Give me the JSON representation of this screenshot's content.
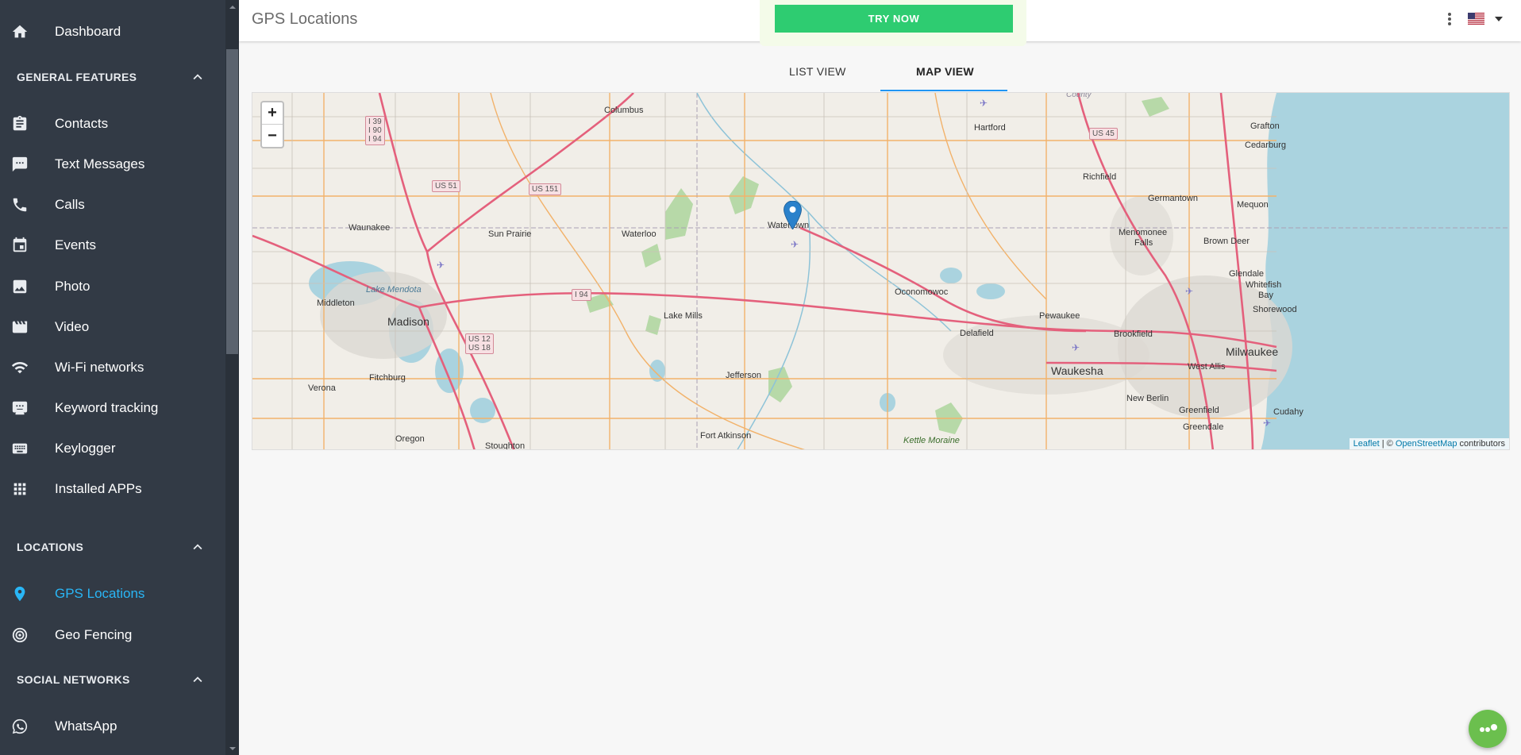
{
  "header": {
    "title": "GPS Locations",
    "try_now": "TRY NOW"
  },
  "tabs": [
    {
      "label": "LIST VIEW"
    },
    {
      "label": "MAP VIEW"
    }
  ],
  "sidebar": {
    "dashboard": "Dashboard",
    "sections": [
      {
        "label": "GENERAL FEATURES",
        "items": [
          "Contacts",
          "Text Messages",
          "Calls",
          "Events",
          "Photo",
          "Video",
          "Wi-Fi networks",
          "Keyword tracking",
          "Keylogger",
          "Installed APPs"
        ]
      },
      {
        "label": "LOCATIONS",
        "items": [
          "GPS Locations",
          "Geo Fencing"
        ]
      },
      {
        "label": "SOCIAL NETWORKS",
        "items": [
          "WhatsApp"
        ]
      }
    ],
    "active_item": "GPS Locations",
    "active_color": "#29b6f6"
  },
  "map": {
    "zoom_in": "+",
    "zoom_out": "−",
    "places": [
      "Columbus",
      "Hartford",
      "Grafton",
      "Cedarburg",
      "Richfield",
      "Germantown",
      "Mequon",
      "Menomonee",
      "Falls",
      "Brown Deer",
      "Waunakee",
      "Sun Prairie",
      "Waterloo",
      "Watertown",
      "Glendale",
      "Whitefish",
      "Bay",
      "Shorewood",
      "Lake Mendota",
      "Middleton",
      "Madison",
      "Lake Mills",
      "Oconomowoc",
      "Pewaukee",
      "Delafield",
      "Brookfield",
      "Milwaukee",
      "Waukesha",
      "West Allis",
      "Fitchburg",
      "Verona",
      "Jefferson",
      "New Berlin",
      "Greenfield",
      "Cudahy",
      "Greendale",
      "Oregon",
      "Stoughton",
      "Fort Atkinson",
      "Kettle Moraine",
      "County"
    ],
    "shields": [
      "I 39\nI 90\nI 94",
      "US 51",
      "US 151",
      "I 94",
      "US 12\nUS 18",
      "US 45"
    ],
    "attribution_leaflet": "Leaflet",
    "attribution_sep": " | © ",
    "attribution_osm": "OpenStreetMap",
    "attribution_tail": " contributors"
  },
  "colors": {
    "sidebar_bg": "#323a45",
    "try_button": "#2ecc71",
    "tab_indicator": "#2196f3",
    "marker": "#2a81cb",
    "water": "#aad3df"
  }
}
